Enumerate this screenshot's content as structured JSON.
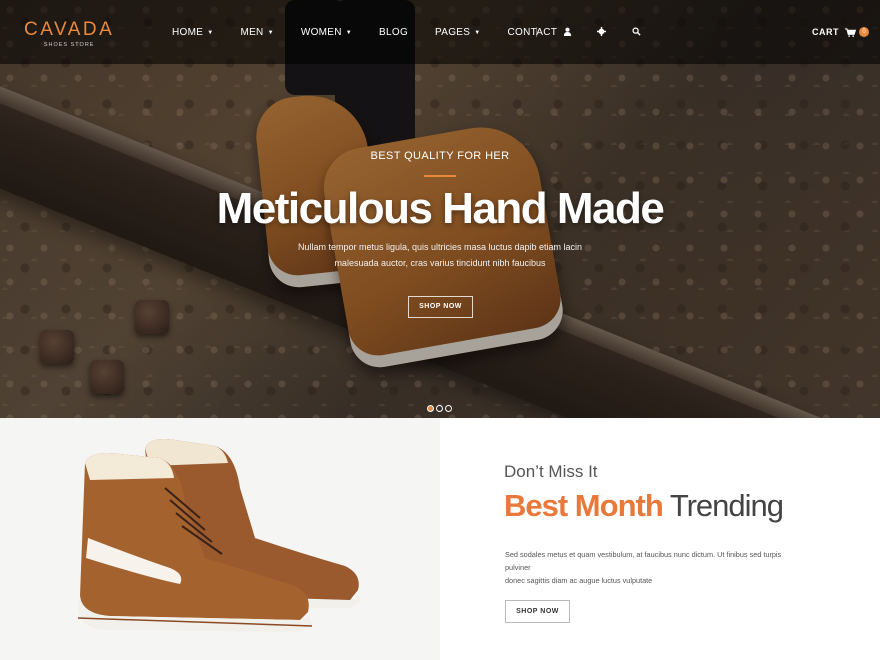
{
  "brand": {
    "name": "CAVADA",
    "tagline": "SHOES STORE",
    "accent_color": "#e8893e"
  },
  "nav": {
    "items": [
      {
        "label": "HOME",
        "has_dropdown": true
      },
      {
        "label": "MEN",
        "has_dropdown": true
      },
      {
        "label": "WOMEN",
        "has_dropdown": true
      },
      {
        "label": "BLOG",
        "has_dropdown": false
      },
      {
        "label": "PAGES",
        "has_dropdown": true
      },
      {
        "label": "CONTACT",
        "has_dropdown": false
      }
    ],
    "icons": [
      "user-icon",
      "gear-icon",
      "search-icon"
    ],
    "cart": {
      "label": "CART",
      "count": "0",
      "icon": "cart-icon"
    }
  },
  "hero": {
    "subtitle": "BEST QUALITY FOR HER",
    "title": "Meticulous Hand Made",
    "description_line1": "Nullam tempor metus ligula, quis ultricies masa luctus dapib etiam lacin",
    "description_line2": "malesuada auctor, cras varius tincidunt nibh faucibus",
    "button_label": "SHOP NOW",
    "slides": 3,
    "active_slide": 1
  },
  "promo": {
    "kicker": "Don’t Miss It",
    "title_accent": "Best Month",
    "title_rest": "Trending",
    "description_line1": "Sed sodales metus et quam vestibulum, at faucibus nunc dictum. Ut finibus sed turpis pulviner",
    "description_line2": "donec sagittis diam ac augue luctus vulputate",
    "button_label": "SHOP NOW"
  }
}
